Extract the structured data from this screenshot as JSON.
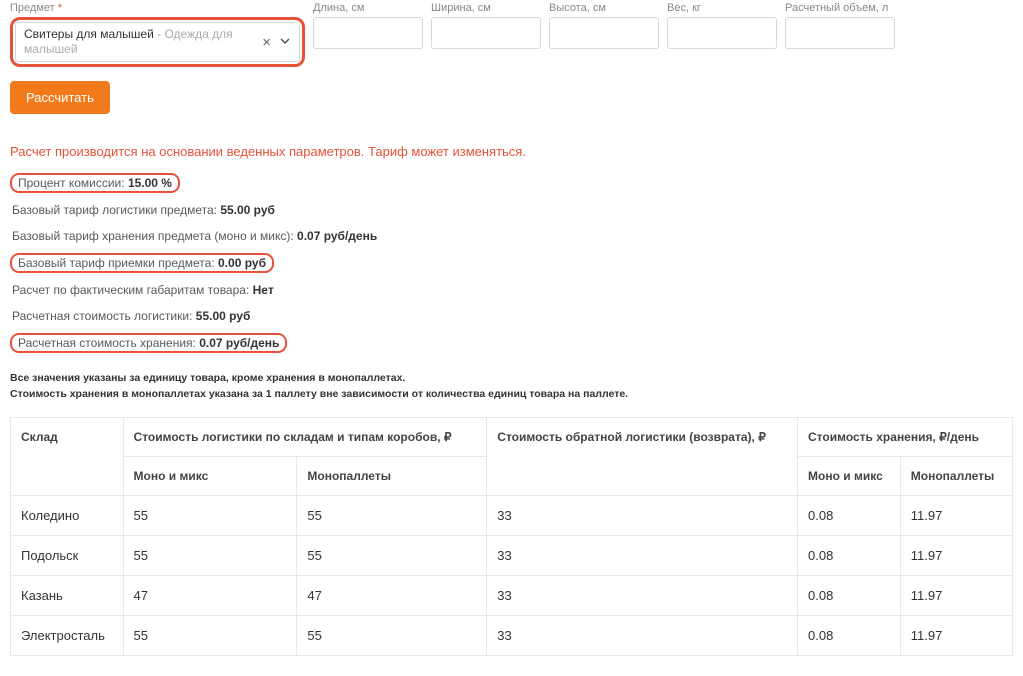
{
  "form": {
    "subject": {
      "label": "Предмет",
      "required": "*",
      "value": "Свитеры для малышей",
      "suffix": " - Одежда для малышей"
    },
    "length": {
      "label": "Длина, см",
      "value": ""
    },
    "width": {
      "label": "Ширина, см",
      "value": ""
    },
    "height": {
      "label": "Высота, см",
      "value": ""
    },
    "weight": {
      "label": "Вес, кг",
      "value": ""
    },
    "volume": {
      "label": "Расчетный объем, л",
      "value": ""
    },
    "calc_button": "Рассчитать"
  },
  "notice": "Расчет производится на основании веденных параметров. Тариф может изменяться.",
  "results": {
    "commission": {
      "label": "Процент комиссии:",
      "value": "15.00 %"
    },
    "base_logistics": {
      "label": "Базовый тариф логистики предмета:",
      "value": "55.00 руб"
    },
    "base_storage": {
      "label": "Базовый тариф хранения предмета (моно и микс):",
      "value": "0.07 руб/день"
    },
    "base_accept": {
      "label": "Базовый тариф приемки предмета:",
      "value": "0.00 руб"
    },
    "actual_dims": {
      "label": "Расчет по фактическим габаритам товара:",
      "value": "Нет"
    },
    "calc_logistics": {
      "label": "Расчетная стоимость логистики:",
      "value": "55.00 руб"
    },
    "calc_storage": {
      "label": "Расчетная стоимость хранения:",
      "value": "0.07 руб/день"
    }
  },
  "footnote": {
    "line1": "Все значения указаны за единицу товара, кроме хранения в монопаллетах.",
    "line2": "Стоимость хранения в монопаллетах указана за 1 паллету вне зависимости от количества единиц товара на паллете."
  },
  "table": {
    "head": {
      "warehouse": "Склад",
      "logistics": "Стоимость логистики по складам и типам коробов, ₽",
      "return": "Стоимость обратной логистики (возврата), ₽",
      "storage": "Стоимость хранения, ₽/день",
      "mono_mix": "Моно и микс",
      "monopal": "Монопаллеты"
    },
    "rows": [
      {
        "name": "Коледино",
        "log_mix": "55",
        "log_pal": "55",
        "ret": "33",
        "st_mix": "0.08",
        "st_pal": "11.97"
      },
      {
        "name": "Подольск",
        "log_mix": "55",
        "log_pal": "55",
        "ret": "33",
        "st_mix": "0.08",
        "st_pal": "11.97"
      },
      {
        "name": "Казань",
        "log_mix": "47",
        "log_pal": "47",
        "ret": "33",
        "st_mix": "0.08",
        "st_pal": "11.97"
      },
      {
        "name": "Электросталь",
        "log_mix": "55",
        "log_pal": "55",
        "ret": "33",
        "st_mix": "0.08",
        "st_pal": "11.97"
      }
    ]
  }
}
